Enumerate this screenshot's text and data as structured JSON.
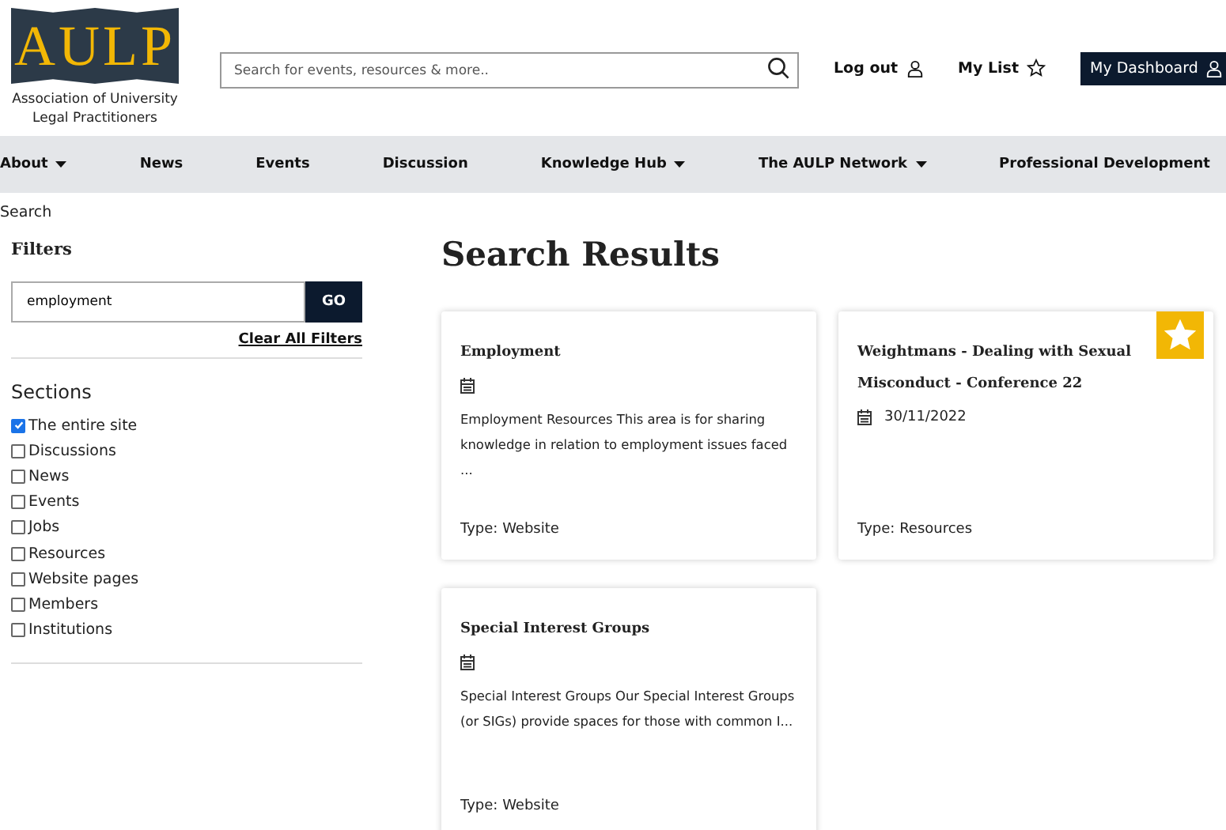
{
  "logo": {
    "letters": "AULP",
    "caption": "Association of University Legal Practitioners"
  },
  "search": {
    "placeholder": "Search for events, resources & more.."
  },
  "header_links": [
    {
      "label": "Log out"
    },
    {
      "label": "My List"
    }
  ],
  "dashboard_button": {
    "label": "My Dashboard"
  },
  "nav": [
    {
      "label": "About",
      "dropdown": true
    },
    {
      "label": "News",
      "dropdown": false
    },
    {
      "label": "Events",
      "dropdown": false
    },
    {
      "label": "Discussion",
      "dropdown": false
    },
    {
      "label": "Knowledge Hub",
      "dropdown": true
    },
    {
      "label": "The AULP Network",
      "dropdown": true
    },
    {
      "label": "Professional Development",
      "dropdown": false
    }
  ],
  "breadcrumb": "Search",
  "filters": {
    "title": "Filters",
    "value": "employment",
    "go": "GO",
    "clear": "Clear All Filters"
  },
  "sections": {
    "title": "Sections",
    "items": [
      {
        "label": "The entire site",
        "checked": true
      },
      {
        "label": "Discussions",
        "checked": false
      },
      {
        "label": "News",
        "checked": false
      },
      {
        "label": "Events",
        "checked": false
      },
      {
        "label": "Jobs",
        "checked": false
      },
      {
        "label": "Resources",
        "checked": false
      },
      {
        "label": "Website pages",
        "checked": false
      },
      {
        "label": "Members",
        "checked": false
      },
      {
        "label": "Institutions",
        "checked": false
      }
    ]
  },
  "results_title": "Search Results",
  "results": [
    {
      "title": "Employment",
      "summary": "Employment Resources This area is for sharing knowledge in relation to employment issues faced ...",
      "type": "Type: Website",
      "favourite": false
    },
    {
      "title": "Weightmans - Dealing with Sexual Misconduct - Conference 22",
      "date": "30/11/2022",
      "type": "Type: Resources",
      "favourite": true
    },
    {
      "title": "Special Interest Groups",
      "summary": "Special Interest Groups Our Special Interest Groups (or SIGs) provide spaces for those with common I...",
      "type": "Type: Website",
      "favourite": false
    }
  ]
}
